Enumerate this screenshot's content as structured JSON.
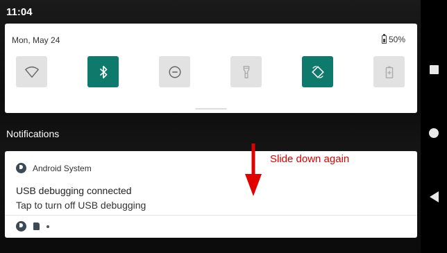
{
  "status_bar": {
    "time": "11:04"
  },
  "quick_settings": {
    "date": "Mon, May 24",
    "battery": "50%",
    "tiles": [
      {
        "icon": "wifi-icon",
        "state": "off"
      },
      {
        "icon": "bluetooth-icon",
        "state": "on"
      },
      {
        "icon": "do-not-disturb-icon",
        "state": "off"
      },
      {
        "icon": "flashlight-icon",
        "state": "off"
      },
      {
        "icon": "auto-rotate-icon",
        "state": "on"
      },
      {
        "icon": "battery-saver-icon",
        "state": "off"
      }
    ]
  },
  "notifications": {
    "header": "Notifications",
    "card": {
      "app_name": "Android System",
      "title": "USB debugging connected",
      "text": "Tap to turn off USB debugging"
    }
  },
  "annotation": {
    "text": "Slide down again"
  },
  "colors": {
    "tile_on": "#0e7a6b",
    "tile_off": "#e2e2e2",
    "annotation": "#e00000"
  }
}
